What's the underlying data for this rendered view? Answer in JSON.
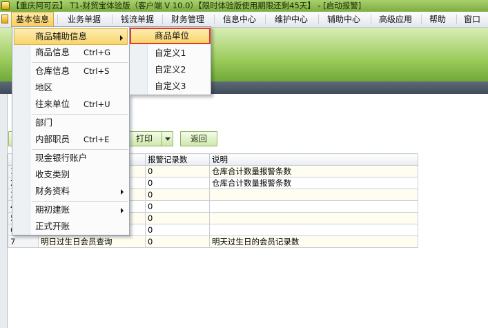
{
  "title": "【重庆阿可云】 T1-财贸宝体验版（客户端 V 10.0）【限时体验版使用期限还剩45天】 - [启动报警]",
  "menubar": [
    "基本信息",
    "业务单据",
    "钱流单据",
    "财务管理",
    "信息中心",
    "维护中心",
    "辅助中心",
    "高级应用",
    "帮助",
    "窗口"
  ],
  "dropdown": {
    "items": [
      {
        "label": "商品辅助信息",
        "shortcut": "",
        "submenu": true
      },
      {
        "label": "商品信息",
        "shortcut": "Ctrl+G",
        "submenu": false
      },
      {
        "label": "仓库信息",
        "shortcut": "Ctrl+S",
        "submenu": false
      },
      {
        "label": "地区",
        "shortcut": "",
        "submenu": false
      },
      {
        "label": "往来单位",
        "shortcut": "Ctrl+U",
        "submenu": false
      },
      {
        "label": "部门",
        "shortcut": "",
        "submenu": false
      },
      {
        "label": "内部职员",
        "shortcut": "Ctrl+E",
        "submenu": false
      },
      {
        "label": "现金银行账户",
        "shortcut": "",
        "submenu": false
      },
      {
        "label": "收支类别",
        "shortcut": "",
        "submenu": false
      },
      {
        "label": "财务资料",
        "shortcut": "",
        "submenu": true
      },
      {
        "label": "期初建账",
        "shortcut": "",
        "submenu": true
      },
      {
        "label": "正式开账",
        "shortcut": "",
        "submenu": false
      }
    ]
  },
  "submenu": {
    "items": [
      "商品单位",
      "自定义1",
      "自定义2",
      "自定义3"
    ]
  },
  "toolbar": {
    "print_label": "打印",
    "back_label": "返回"
  },
  "grid": {
    "columns": [
      "",
      "",
      "报警记录数",
      "说明"
    ],
    "rows": [
      {
        "num": "1",
        "name": "",
        "count": "0",
        "desc": "仓库合计数量报警条数"
      },
      {
        "num": "2",
        "name": "",
        "count": "0",
        "desc": "仓库合计数量报警条数"
      },
      {
        "num": "3",
        "name": "",
        "count": "0",
        "desc": ""
      },
      {
        "num": "4",
        "name": "",
        "count": "0",
        "desc": ""
      },
      {
        "num": "5",
        "name": "",
        "count": "0",
        "desc": ""
      },
      {
        "num": "6",
        "name": "",
        "count": "0",
        "desc": ""
      },
      {
        "num": "7",
        "name": "明日过生日会员查询",
        "count": "0",
        "desc": "明天过生日的会员记录数"
      }
    ]
  }
}
